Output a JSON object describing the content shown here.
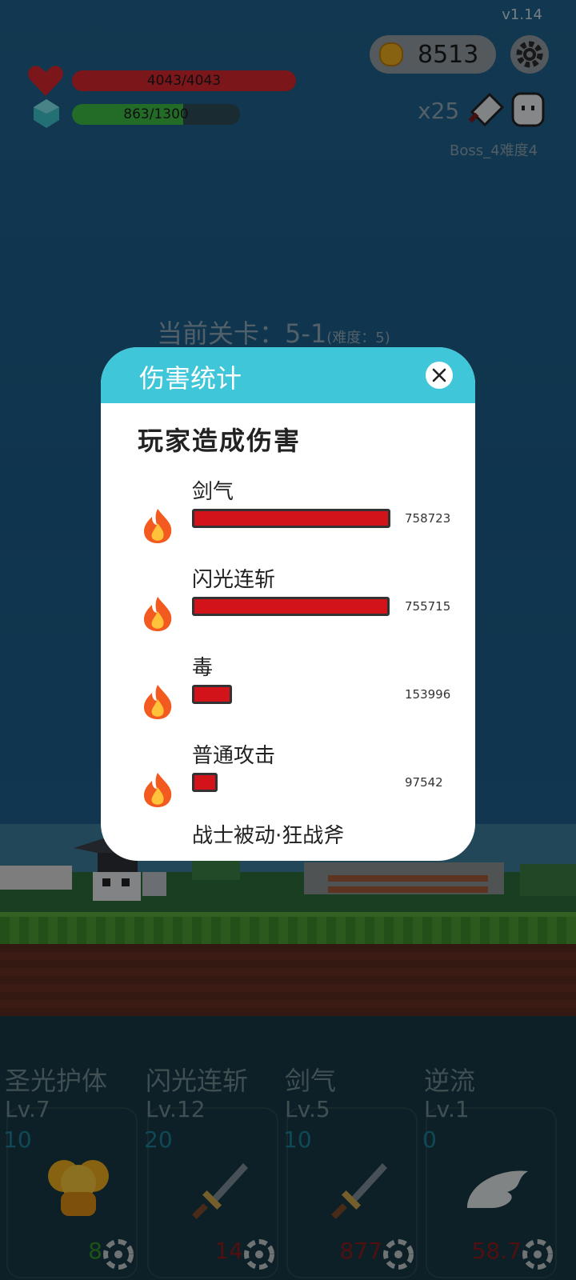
{
  "version": "v1.14",
  "player": {
    "hp_text": "4043/4043",
    "hp_fraction": 1.0,
    "mp_text": "863/1300",
    "mp_fraction": 0.66
  },
  "coins": "8513",
  "boss": {
    "count": "x25",
    "label": "Boss_4难度4"
  },
  "stage": {
    "text": "当前关卡：5-1",
    "difficulty": "(难度：5)"
  },
  "skills": [
    {
      "name": "圣光护体",
      "level": "Lv.7",
      "num": "10",
      "value": "8",
      "value_color": "#2f8f2a",
      "icon": "golden-lantern-icon"
    },
    {
      "name": "闪光连斩",
      "level": "Lv.12",
      "num": "20",
      "value": "14",
      "value_color": "#8a1d1d",
      "icon": "sword-icon"
    },
    {
      "name": "剑气",
      "level": "Lv.5",
      "num": "10",
      "value": "877",
      "value_color": "#8a1d1d",
      "icon": "sword-icon"
    },
    {
      "name": "逆流",
      "level": "Lv.1",
      "num": "0",
      "value": "58.7",
      "value_color": "#8a1d1d",
      "icon": "wing-icon"
    }
  ],
  "modal": {
    "title": "伤害统计",
    "section": "玩家造成伤害",
    "rows": [
      {
        "label": "剑气",
        "value": "758723",
        "fraction": 1.0
      },
      {
        "label": "闪光连斩",
        "value": "755715",
        "fraction": 0.996
      },
      {
        "label": "毒",
        "value": "153996",
        "fraction": 0.203
      },
      {
        "label": "普通攻击",
        "value": "97542",
        "fraction": 0.129
      },
      {
        "label": "战士被动·狂战斧",
        "value": "",
        "fraction": 0
      }
    ]
  },
  "colors": {
    "accent": "#3fc6d8",
    "damage_bar": "#d21319",
    "hp": "#d4262f",
    "mp": "#3cba45"
  }
}
